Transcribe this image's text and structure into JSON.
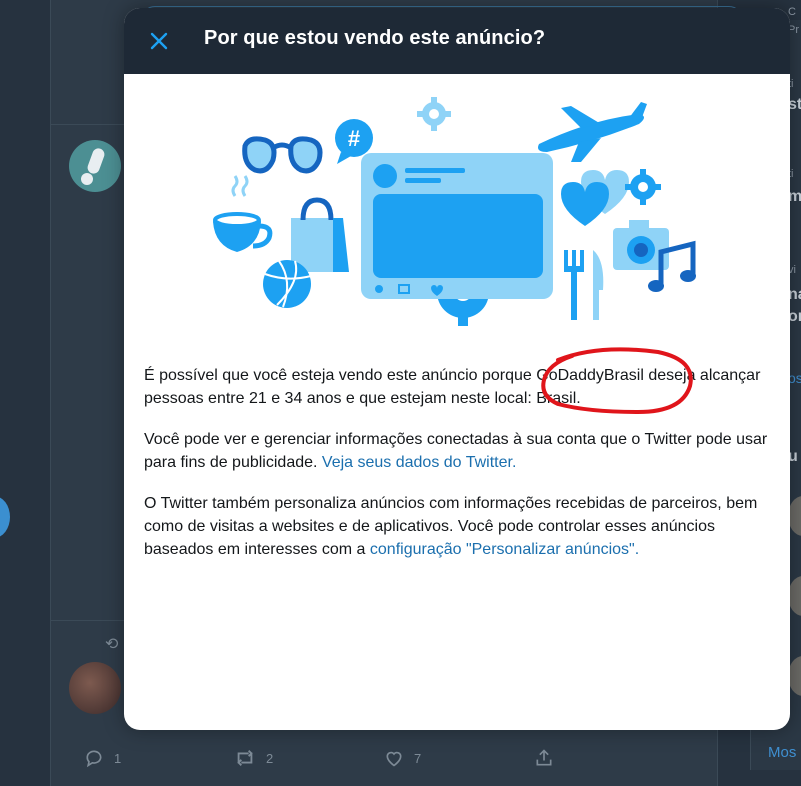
{
  "modal": {
    "title": "Por que estou vendo este anúncio?",
    "close_icon": "close-icon",
    "paragraph1": {
      "before": "É possível que você esteja vendo este anúncio porque ",
      "advertiser": "GoDaddyBrasil",
      "after": " deseja alcançar pessoas entre 21 e 34 anos e que estejam neste local: Brasil."
    },
    "paragraph2": {
      "text": "Você pode ver e gerenciar informações conectadas à sua conta que o Twitter pode usar para fins de publicidade. ",
      "link": "Veja seus dados do Twitter."
    },
    "paragraph3": {
      "text": "O Twitter também personaliza anúncios com informações recebidas de parceiros, bem como de visitas a websites e de aplicativos. Você pode controlar esses anúncios baseados em interesses com a ",
      "link": "configuração \"Personalizar anúncios\"."
    },
    "illustration_icons": [
      "sunglasses-icon",
      "hashtag-bubble-icon",
      "gear-icon",
      "airplane-icon",
      "tweet-card-icon",
      "heart-icon",
      "coffee-cup-icon",
      "shopping-bag-icon",
      "basketball-icon",
      "fork-knife-icon",
      "camera-icon",
      "music-note-icon"
    ]
  },
  "timeline": {
    "actions": [
      {
        "icon": "reply-icon",
        "count": "1"
      },
      {
        "icon": "retweet-icon",
        "count": "2"
      },
      {
        "icon": "like-icon",
        "count": "7"
      },
      {
        "icon": "share-icon",
        "count": ""
      }
    ]
  },
  "right_sidebar": {
    "more_link": "Mos"
  },
  "colors": {
    "modal_header": "#1e2936",
    "link": "#1b6fae",
    "illustration_light": "#8fd3f7",
    "illustration_dark": "#1da1f2",
    "annotation_red": "#e0151b"
  }
}
